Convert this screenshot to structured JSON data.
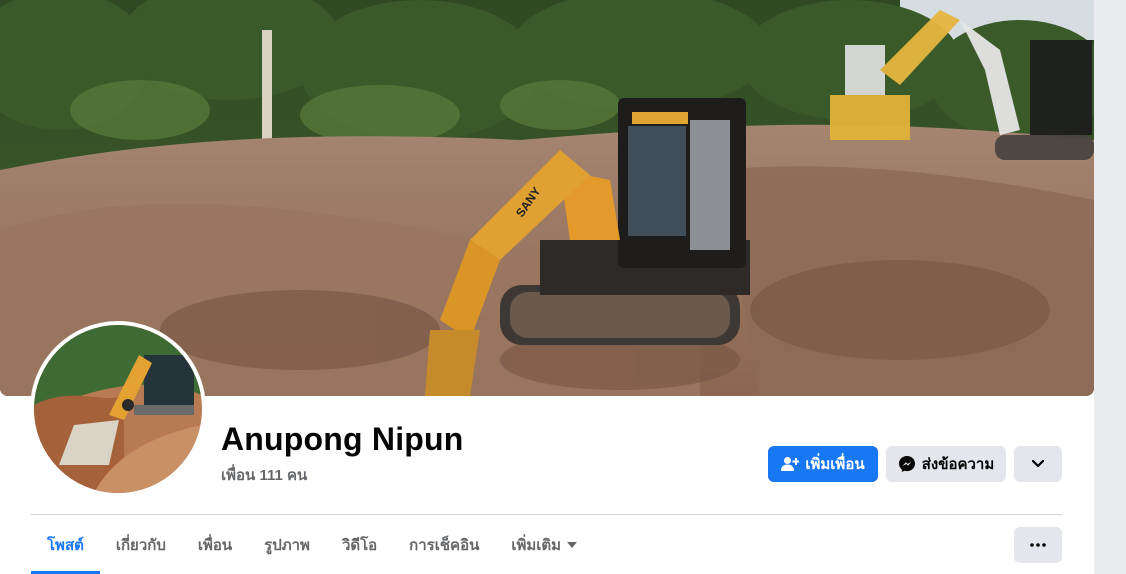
{
  "profile": {
    "name": "Anupong Nipun",
    "friends_count": "เพื่อน 111 คน"
  },
  "actions": {
    "add_friend_label": "เพิ่มเพื่อน",
    "message_label": "ส่งข้อความ"
  },
  "tabs": [
    {
      "label": "โพสต์",
      "active": true
    },
    {
      "label": "เกี่ยวกับ",
      "active": false
    },
    {
      "label": "เพื่อน",
      "active": false
    },
    {
      "label": "รูปภาพ",
      "active": false
    },
    {
      "label": "วิดีโอ",
      "active": false
    },
    {
      "label": "การเช็คอิน",
      "active": false
    },
    {
      "label": "เพิ่มเติม",
      "active": false
    }
  ],
  "cover_photo": {
    "machine_label": "SANY"
  },
  "icons": {
    "add_friend": "person-plus-icon",
    "message": "messenger-icon",
    "more": "chevron-down-icon",
    "tab_more": "caret-down-icon",
    "overflow": "ellipsis-icon"
  },
  "colors": {
    "accent": "#1877f2",
    "secondary_button": "#e4e6eb",
    "muted_text": "#65676b"
  }
}
